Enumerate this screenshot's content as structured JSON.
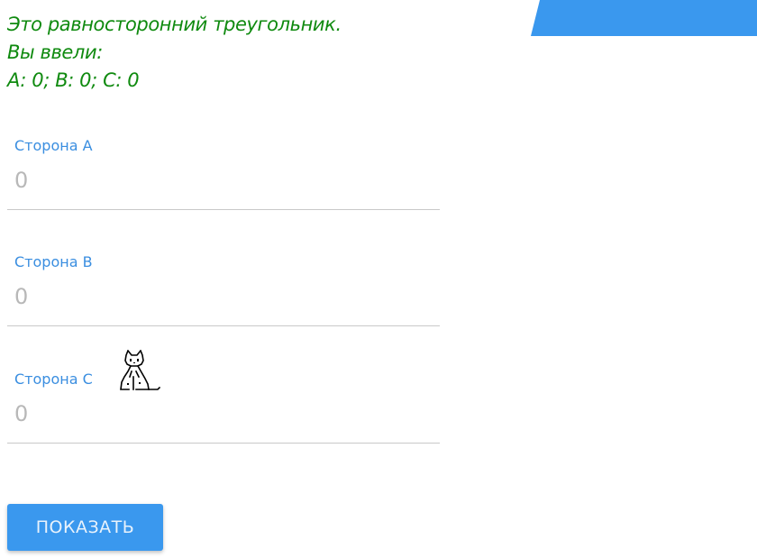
{
  "result": {
    "line1": "Это равносторонний треугольник.",
    "line2": "Вы ввели:",
    "line3": "A: 0; B: 0; C: 0"
  },
  "form": {
    "fields": [
      {
        "label": "Сторона A",
        "value": "",
        "placeholder": "0"
      },
      {
        "label": "Сторона B",
        "value": "",
        "placeholder": "0"
      },
      {
        "label": "Сторона C",
        "value": "",
        "placeholder": "0"
      }
    ],
    "submit_label": "ПОКАЗАТЬ"
  },
  "colors": {
    "accent": "#3a98ee",
    "success_text": "#0f8a0f",
    "label": "#3a8ee0"
  },
  "icons": {
    "mascot": "pixel-cat-icon",
    "banner": "corner-banner"
  }
}
